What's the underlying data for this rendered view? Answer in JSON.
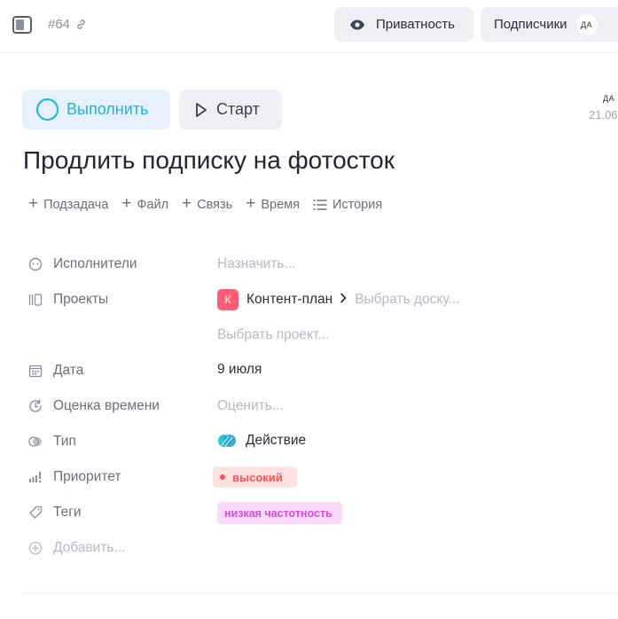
{
  "header": {
    "task_id": "#64",
    "privacy_label": "Приватность",
    "subscribers_label": "Подписчики",
    "subscriber_avatar": "ДА"
  },
  "toolbar": {
    "complete_label": "Выполнить",
    "start_label": "Старт"
  },
  "meta": {
    "author_avatar": "ДА",
    "date": "21.06"
  },
  "task": {
    "title": "Продлить подписку на фотосток"
  },
  "actions": [
    {
      "label": "Подзадача",
      "icon": "plus-icon"
    },
    {
      "label": "Файл",
      "icon": "plus-icon"
    },
    {
      "label": "Связь",
      "icon": "plus-icon"
    },
    {
      "label": "Время",
      "icon": "plus-icon"
    },
    {
      "label": "История",
      "icon": "list-icon"
    }
  ],
  "properties": {
    "assignees": {
      "label": "Исполнители",
      "placeholder": "Назначить..."
    },
    "projects": {
      "label": "Проекты",
      "project_badge": "К",
      "project_badge_color": "#ff5c75",
      "project_name": "Контент-план",
      "board_placeholder": "Выбрать доску...",
      "project_placeholder": "Выбрать проект..."
    },
    "date": {
      "label": "Дата",
      "value": "9 июля"
    },
    "estimate": {
      "label": "Оценка времени",
      "placeholder": "Оценить..."
    },
    "type": {
      "label": "Тип",
      "value": "Действие"
    },
    "priority": {
      "label": "Приоритет",
      "value": "высокий",
      "color": "#f0575a"
    },
    "tags": {
      "label": "Теги",
      "value": "низкая частотность",
      "color": "#d24ed6"
    },
    "add": {
      "label": "Добавить..."
    }
  },
  "colors": {
    "accent": "#1db4d6"
  }
}
